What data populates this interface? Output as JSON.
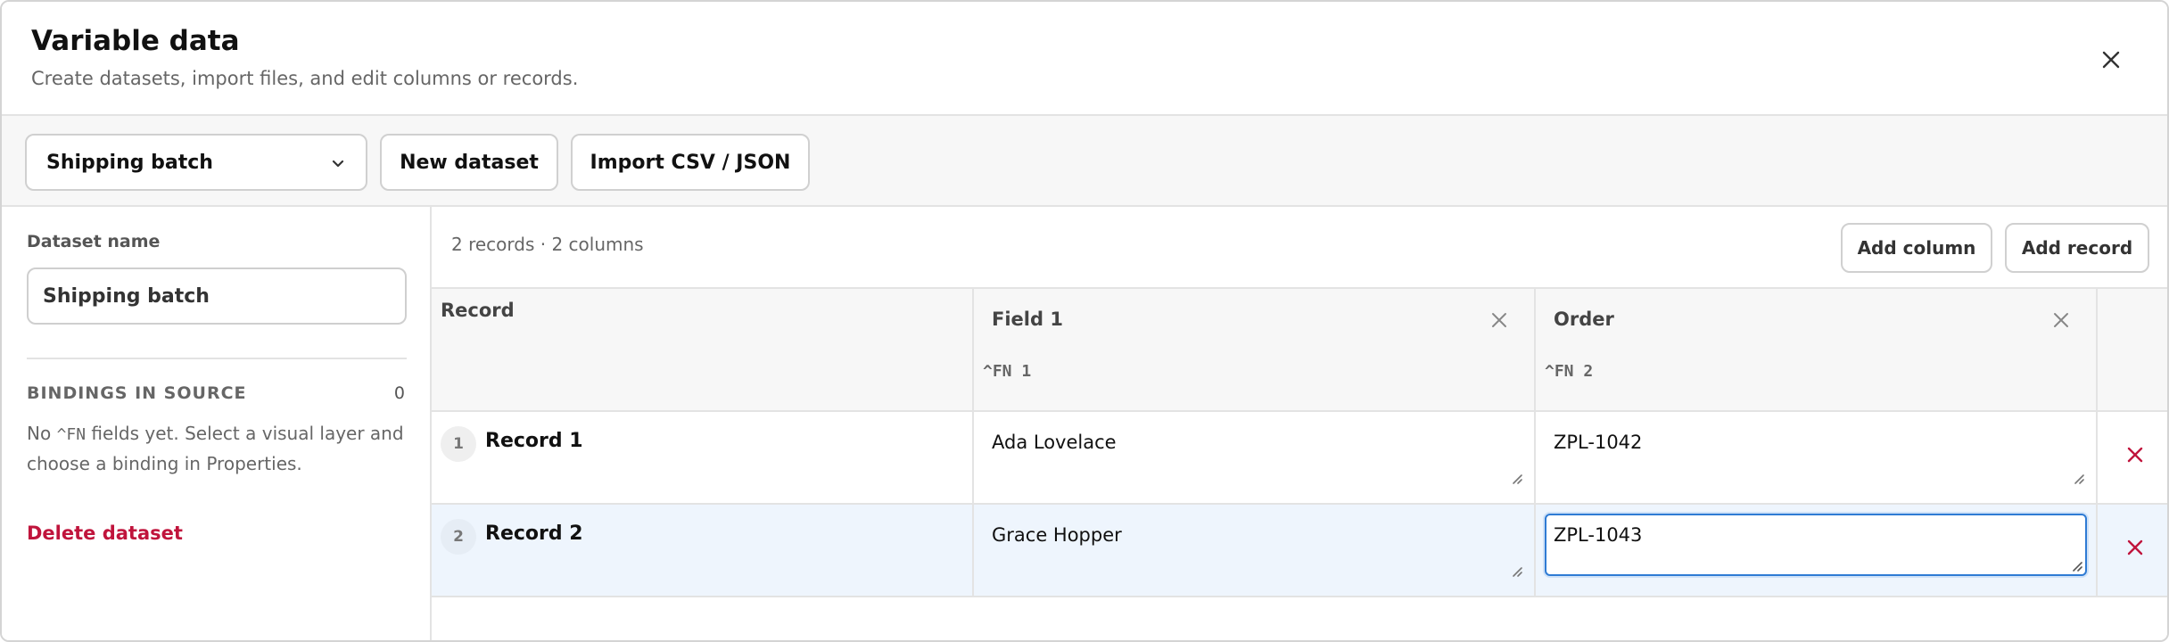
{
  "header": {
    "title": "Variable data",
    "subtitle": "Create datasets, import files, and edit columns or records."
  },
  "toolbar": {
    "dataset_select": "Shipping batch",
    "new_dataset": "New dataset",
    "import": "Import CSV / JSON"
  },
  "sidebar": {
    "name_label": "Dataset name",
    "name_value": "Shipping batch",
    "bindings_label": "BINDINGS IN SOURCE",
    "bindings_count": "0",
    "note_pre": "No ",
    "note_code": "^FN",
    "note_post": " fields yet. Select a visual layer and choose a binding in Properties.",
    "delete_label": "Delete dataset"
  },
  "main": {
    "summary": "2 records · 2 columns",
    "add_column": "Add column",
    "add_record": "Add record",
    "record_header": "Record",
    "columns": [
      {
        "name": "Field 1",
        "code": "^FN 1"
      },
      {
        "name": "Order",
        "code": "^FN 2"
      }
    ],
    "rows": [
      {
        "num": "1",
        "name": "Record 1",
        "values": [
          "Ada Lovelace",
          "ZPL-1042"
        ]
      },
      {
        "num": "2",
        "name": "Record 2",
        "values": [
          "Grace Hopper",
          "ZPL-1043"
        ]
      }
    ]
  },
  "colors": {
    "accent": "#2f7bd4",
    "danger": "#c0143c",
    "selected_row": "#eef5fd"
  },
  "icons": [
    "close-icon",
    "chevron-down-icon",
    "resize-grip-icon",
    "delete-row-icon"
  ]
}
